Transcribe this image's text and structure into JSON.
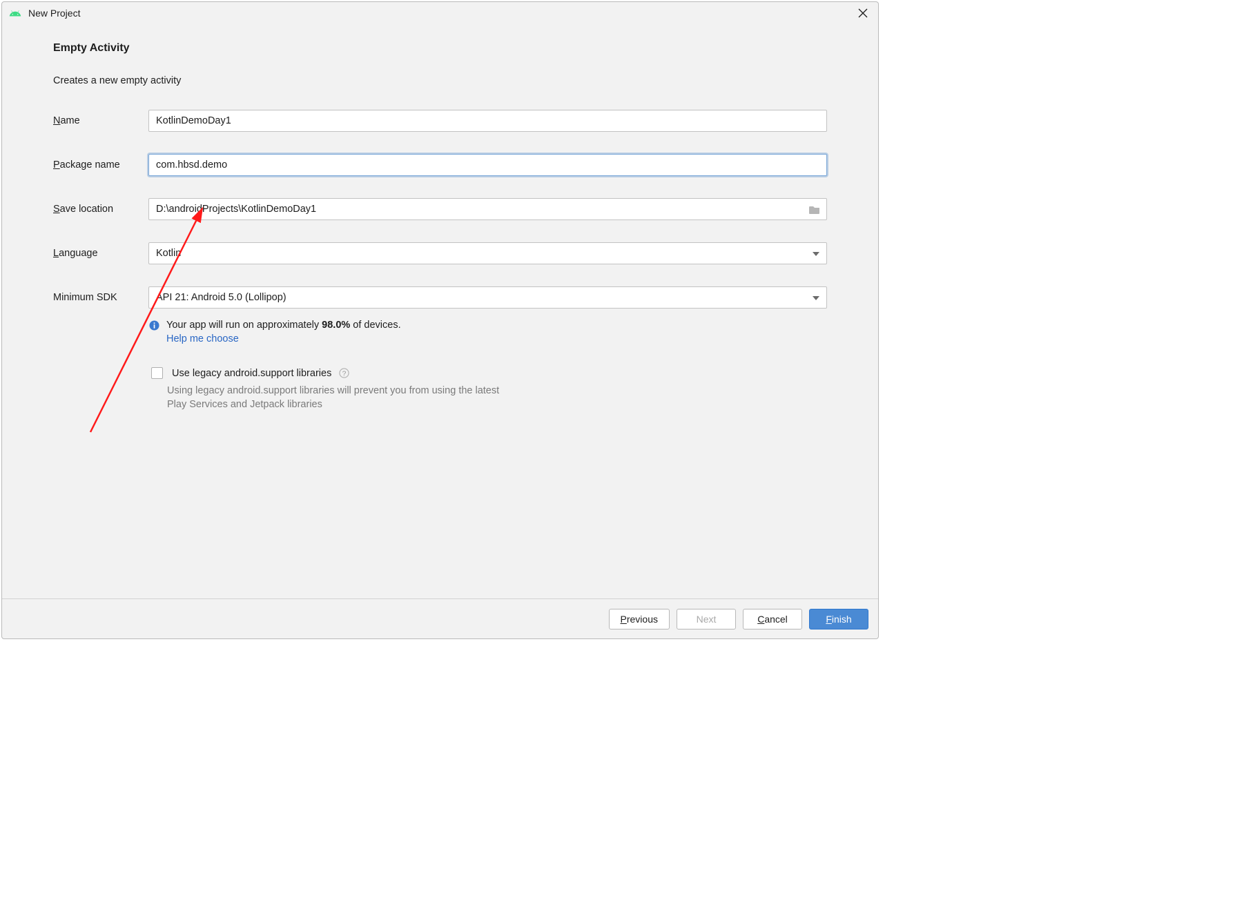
{
  "titlebar": {
    "title": "New Project"
  },
  "heading": "Empty Activity",
  "subheading": "Creates a new empty activity",
  "labels": {
    "name_pre": "N",
    "name_post": "ame",
    "package_pre": "P",
    "package_post": "ackage name",
    "save_pre": "S",
    "save_post": "ave location",
    "lang_pre": "L",
    "lang_post": "anguage",
    "minsdk": "Minimum SDK"
  },
  "fields": {
    "name": "KotlinDemoDay1",
    "package": "com.hbsd.demo",
    "save_location": "D:\\androidProjects\\KotlinDemoDay1",
    "language": "Kotlin",
    "min_sdk": "API 21: Android 5.0 (Lollipop)"
  },
  "info": {
    "prefix": "Your app will run on approximately ",
    "percent": "98.0%",
    "suffix": " of devices.",
    "help_link": "Help me choose"
  },
  "legacy": {
    "label": "Use legacy android.support libraries",
    "desc": "Using legacy android.support libraries will prevent you from using the latest Play Services and Jetpack libraries"
  },
  "buttons": {
    "previous_pre": "P",
    "previous_post": "revious",
    "next": "Next",
    "cancel_pre": "C",
    "cancel_post": "ancel",
    "finish_pre": "F",
    "finish_post": "inish"
  }
}
